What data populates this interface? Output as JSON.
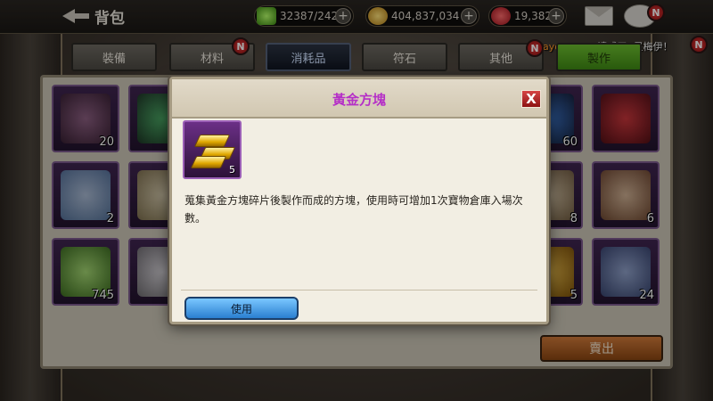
{
  "topbar": {
    "back_label": "背包",
    "energy": "32387/242",
    "gold": "404,837,034",
    "gems": "19,382",
    "chat_badge": "N"
  },
  "notice": {
    "player": "Sayonan777",
    "message": "達成了5星梅伊！"
  },
  "tabs": [
    {
      "label": "裝備",
      "badge": ""
    },
    {
      "label": "材料",
      "badge": "N"
    },
    {
      "label": "消耗品",
      "badge": ""
    },
    {
      "label": "符石",
      "badge": ""
    },
    {
      "label": "其他",
      "badge": "N"
    },
    {
      "label": "製作",
      "badge": ""
    }
  ],
  "inventory": {
    "counts": [
      "20",
      "60",
      "2",
      "8",
      "6",
      "745",
      "5",
      "24"
    ],
    "sell_label": "賣出"
  },
  "modal": {
    "title": "黃金方塊",
    "item_count": "5",
    "description": "蒐集黃金方塊碎片後製作而成的方塊，使用時可增加1次寶物倉庫入場次數。",
    "use_label": "使用",
    "close_label": "X"
  },
  "colors": {
    "title_purple": "#b52fc7",
    "use_blue": "#2a7fd0",
    "sell_orange": "#d17a3a",
    "craft_green": "#6dbe2f"
  }
}
